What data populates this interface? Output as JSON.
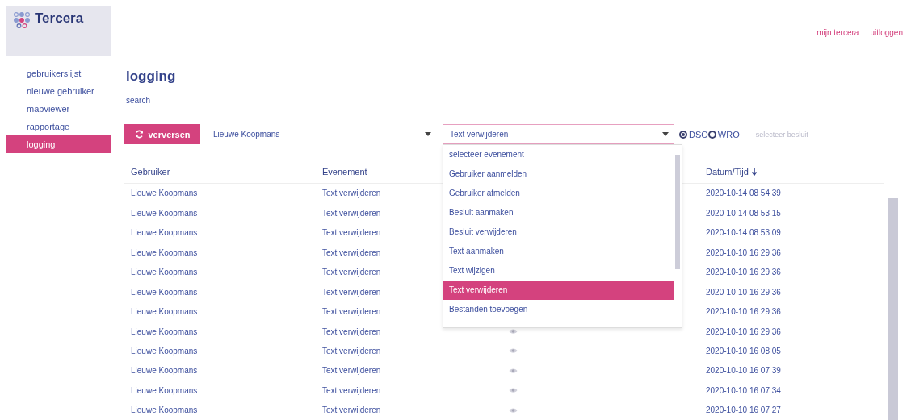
{
  "logo": {
    "name": "Tercera"
  },
  "sidebar": {
    "items": [
      {
        "label": "gebruikerslijst",
        "selected": false
      },
      {
        "label": "nieuwe gebruiker",
        "selected": false
      },
      {
        "label": "mapviewer",
        "selected": false
      },
      {
        "label": "rapportage",
        "selected": false
      },
      {
        "label": "logging",
        "selected": true
      }
    ]
  },
  "header_links": [
    "mijn tercera",
    "uitloggen"
  ],
  "title": "logging",
  "search_label": "search",
  "toolbar": {
    "refresh_button": "verversen",
    "user_select": {
      "value": "Lieuwe Koopmans"
    },
    "event_select": {
      "value": "Text verwijderen",
      "expanded": true
    },
    "radios": [
      {
        "label": "DSO",
        "selected": true
      },
      {
        "label": "WRO",
        "selected": false
      }
    ],
    "decision_select": {
      "placeholder": "selecteer besluit"
    }
  },
  "dropdown_options": [
    {
      "label": "selecteer evenement",
      "selected": false
    },
    {
      "label": "Gebruiker aanmelden",
      "selected": false
    },
    {
      "label": "Gebruiker afmelden",
      "selected": false
    },
    {
      "label": "Besluit aanmaken",
      "selected": false
    },
    {
      "label": "Besluit verwijderen",
      "selected": false
    },
    {
      "label": "Text aanmaken",
      "selected": false
    },
    {
      "label": "Text wijzigen",
      "selected": false
    },
    {
      "label": "Text verwijderen",
      "selected": true
    },
    {
      "label": "Bestanden toevoegen",
      "selected": false
    }
  ],
  "table": {
    "columns": [
      "Gebruiker",
      "Evenement",
      "Datum/Tijd"
    ],
    "rows": [
      {
        "user": "Lieuwe Koopmans",
        "event": "Text verwijderen",
        "datetime": "2020-10-14 08 54 39"
      },
      {
        "user": "Lieuwe Koopmans",
        "event": "Text verwijderen",
        "datetime": "2020-10-14 08 53 15"
      },
      {
        "user": "Lieuwe Koopmans",
        "event": "Text verwijderen",
        "datetime": "2020-10-14 08 53 09"
      },
      {
        "user": "Lieuwe Koopmans",
        "event": "Text verwijderen",
        "datetime": "2020-10-10 16 29 36"
      },
      {
        "user": "Lieuwe Koopmans",
        "event": "Text verwijderen",
        "datetime": "2020-10-10 16 29 36"
      },
      {
        "user": "Lieuwe Koopmans",
        "event": "Text verwijderen",
        "datetime": "2020-10-10 16 29 36"
      },
      {
        "user": "Lieuwe Koopmans",
        "event": "Text verwijderen",
        "datetime": "2020-10-10 16 29 36"
      },
      {
        "user": "Lieuwe Koopmans",
        "event": "Text verwijderen",
        "datetime": "2020-10-10 16 29 36"
      },
      {
        "user": "Lieuwe Koopmans",
        "event": "Text verwijderen",
        "datetime": "2020-10-10 16 08 05"
      },
      {
        "user": "Lieuwe Koopmans",
        "event": "Text verwijderen",
        "datetime": "2020-10-10 16 07 39"
      },
      {
        "user": "Lieuwe Koopmans",
        "event": "Text verwijderen",
        "datetime": "2020-10-10 16 07 34"
      },
      {
        "user": "Lieuwe Koopmans",
        "event": "Text verwijderen",
        "datetime": "2020-10-10 16 07 27"
      }
    ]
  }
}
